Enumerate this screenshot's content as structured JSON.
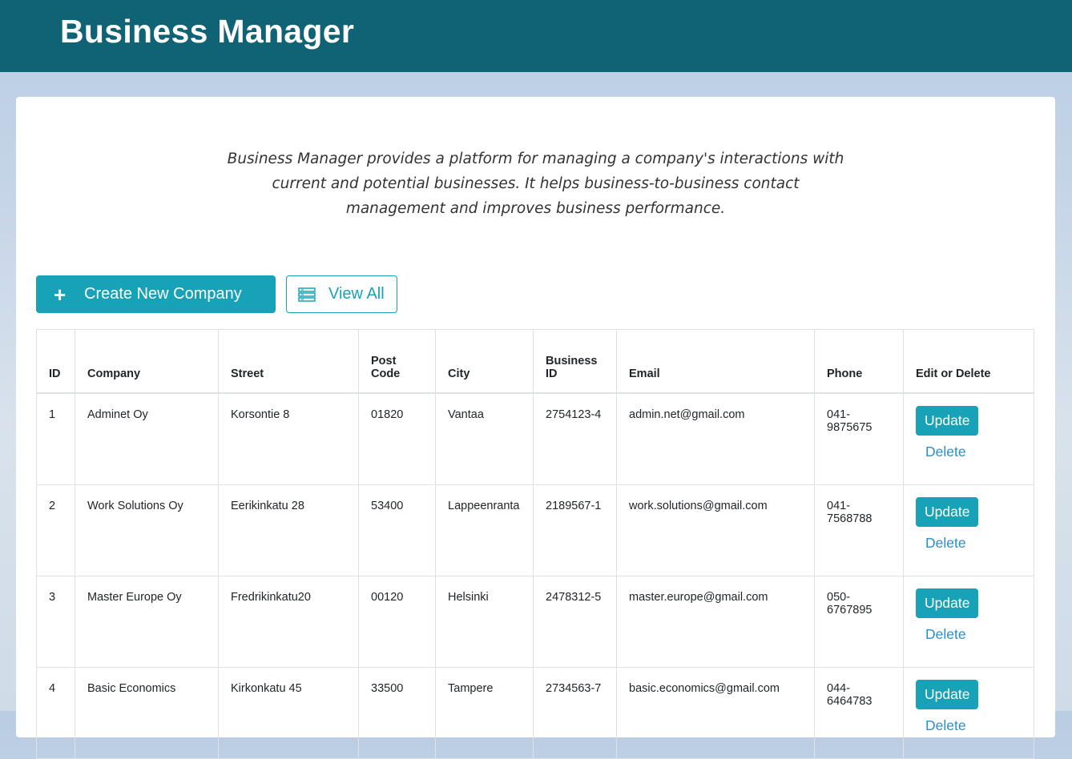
{
  "header": {
    "title": "Business Manager"
  },
  "intro": {
    "text": "Business Manager provides a platform for managing a company's interactions with current and potential businesses. It helps business-to-business contact management and improves business performance."
  },
  "actions": {
    "create_label": "Create New Company",
    "view_label": "View All"
  },
  "table": {
    "columns": [
      "ID",
      "Company",
      "Street",
      "Post Code",
      "City",
      "Business ID",
      "Email",
      "Phone",
      "Edit or Delete"
    ],
    "rows": [
      {
        "id": "1",
        "company": "Adminet Oy",
        "street": "Korsontie 8",
        "post_code": "01820",
        "city": "Vantaa",
        "business_id": "2754123-4",
        "email": "admin.net@gmail.com",
        "phone_a": "041-",
        "phone_b": "9875675"
      },
      {
        "id": "2",
        "company": "Work Solutions Oy",
        "street": "Eerikinkatu 28",
        "post_code": "53400",
        "city": "Lappeenranta",
        "business_id": "2189567-1",
        "email": "work.solutions@gmail.com",
        "phone_a": "041-",
        "phone_b": "7568788"
      },
      {
        "id": "3",
        "company": "Master Europe Oy",
        "street": "Fredrikinkatu20",
        "post_code": "00120",
        "city": "Helsinki",
        "business_id": "2478312-5",
        "email": "master.europe@gmail.com",
        "phone_a": "050-",
        "phone_b": "6767895"
      },
      {
        "id": "4",
        "company": "Basic Economics",
        "street": "Kirkonkatu 45",
        "post_code": "33500",
        "city": "Tampere",
        "business_id": "2734563-7",
        "email": "basic.economics@gmail.com",
        "phone_a": "044-",
        "phone_b": "6464783"
      }
    ],
    "update_label": "Update",
    "delete_label": "Delete"
  },
  "colors": {
    "header_bg": "#0f6374",
    "accent": "#17a2b8",
    "link": "#2a8fc7"
  }
}
